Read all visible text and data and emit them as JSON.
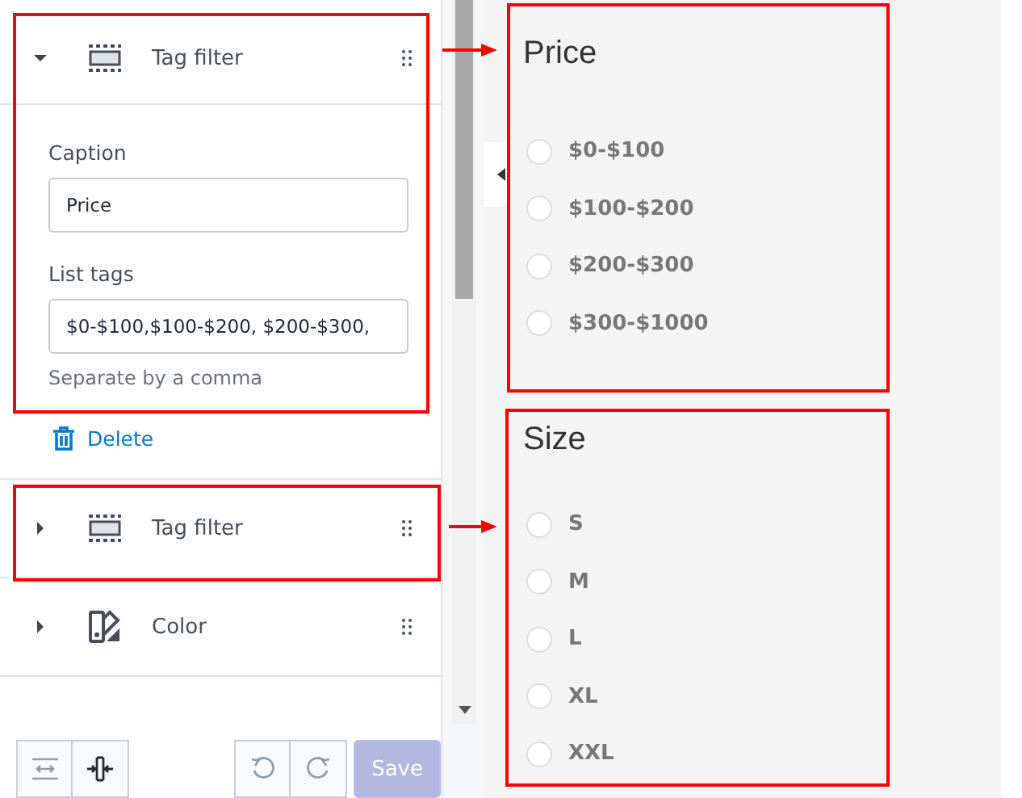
{
  "sections": [
    {
      "kind": "tag_filter",
      "title": "Tag filter",
      "expanded": true,
      "fields": [
        {
          "label": "Caption",
          "value": "Price"
        },
        {
          "label": "List tags",
          "value": "$0-$100,$100-$200, $200-$300,"
        }
      ],
      "hint": "Separate by a comma",
      "delete": "Delete"
    },
    {
      "kind": "tag_filter",
      "title": "Tag filter",
      "expanded": false
    },
    {
      "kind": "color",
      "title": "Color",
      "expanded": false
    }
  ],
  "footer": {
    "save": "Save",
    "save_disabled": true
  },
  "preview": [
    {
      "caption": "Price",
      "options": [
        {
          "label": "$0-$100",
          "selected": false
        },
        {
          "label": "$100-$200",
          "selected": false
        },
        {
          "label": "$200-$300",
          "selected": false
        },
        {
          "label": "$300-$1000",
          "selected": false
        }
      ]
    },
    {
      "caption": "Size",
      "options": [
        {
          "label": "S",
          "selected": false
        },
        {
          "label": "M",
          "selected": false
        },
        {
          "label": "L",
          "selected": false
        },
        {
          "label": "XL",
          "selected": false
        },
        {
          "label": "XXL",
          "selected": false
        }
      ]
    }
  ]
}
